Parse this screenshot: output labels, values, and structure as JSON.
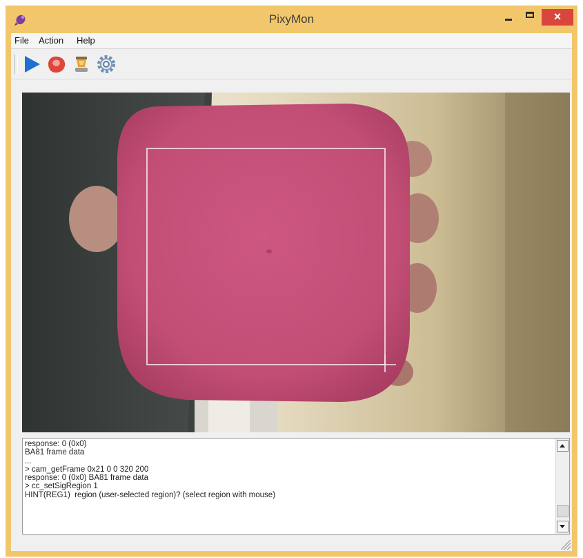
{
  "window": {
    "title": "PixyMon",
    "close_glyph": "×"
  },
  "menu": {
    "items": [
      "File",
      "Action",
      "Help"
    ]
  },
  "toolbar": {
    "buttons": [
      {
        "icon": "play-icon",
        "color": "#1f6fd1"
      },
      {
        "icon": "raw-video-icon",
        "color": "#e0453a"
      },
      {
        "icon": "cooked-video-icon",
        "color": "#c98a2a"
      },
      {
        "icon": "gear-icon",
        "color": "#5a7fa8"
      }
    ]
  },
  "console": {
    "text": "response: 0 (0x0)\nBA81 frame data\n...\n> cam_getFrame 0x21 0 0 320 200\nresponse: 0 (0x0) BA81 frame data\n> cc_setSigRegion 1\nHINT(REG1)  region (user-selected region)? (select region with mouse)"
  },
  "colors": {
    "title_bar": "#f2c76b",
    "close_button": "#d9463d",
    "object_pink": "#c94f78"
  }
}
